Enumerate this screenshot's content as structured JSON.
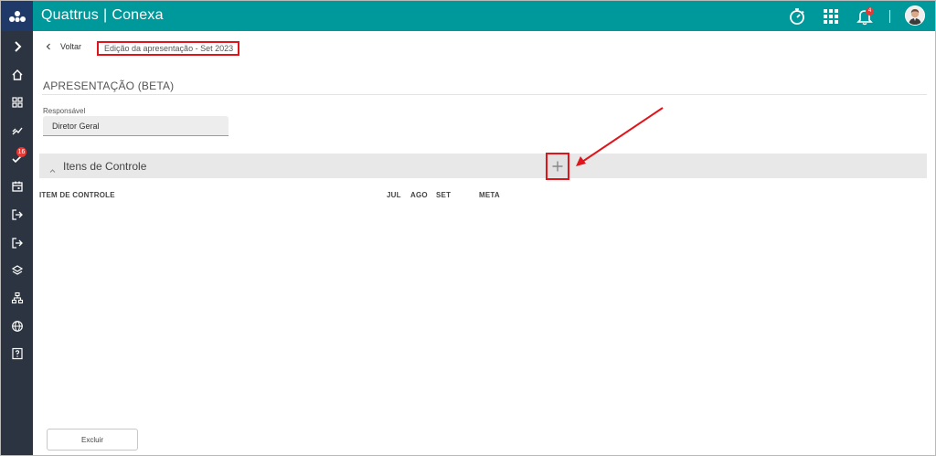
{
  "app": {
    "brand_name": "Quattrus",
    "brand_separator": "|",
    "product_name": "Conexa"
  },
  "topbar": {
    "notification_count": "4",
    "icons": [
      "stopwatch-icon",
      "apps-grid-icon",
      "notification-bell-icon",
      "user-avatar"
    ]
  },
  "sidebar": {
    "items": [
      {
        "icon": "chevron-right-icon"
      },
      {
        "icon": "home-icon"
      },
      {
        "icon": "dashboard-icon"
      },
      {
        "icon": "trend-icon"
      },
      {
        "icon": "tasks-icon",
        "badge": "16"
      },
      {
        "icon": "calendar-icon"
      },
      {
        "icon": "login-icon"
      },
      {
        "icon": "logout-icon"
      },
      {
        "icon": "layers-icon"
      },
      {
        "icon": "hierarchy-icon"
      },
      {
        "icon": "globe-icon"
      },
      {
        "icon": "help-icon"
      }
    ]
  },
  "nav": {
    "back_label": "Voltar",
    "breadcrumb": "Edição da apresentação - Set 2023"
  },
  "page": {
    "title": "APRESENTAÇÃO (BETA)",
    "responsavel_label": "Responsável",
    "responsavel_value": "Diretor Geral"
  },
  "section": {
    "title": "Itens de Controle",
    "add_icon": "plus-icon"
  },
  "table": {
    "columns": [
      "ITEM DE CONTROLE",
      "JUL",
      "AGO",
      "SET",
      "META"
    ],
    "rows": []
  },
  "footer": {
    "delete_label": "Excluir"
  },
  "colors": {
    "topbar": "#00999b",
    "sidebar": "#2b3440",
    "logo_bg": "#1f3a68",
    "highlight": "#e0151b"
  }
}
